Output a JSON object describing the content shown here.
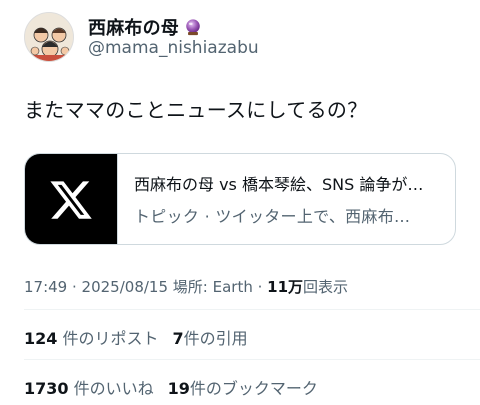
{
  "author": {
    "display_name": "西麻布の母",
    "handle": "@mama_nishiazabu"
  },
  "tweet": {
    "text": "またママのことニュースにしてるの？"
  },
  "card": {
    "title": "西麻布の母 vs 橋本琴絵、SNS 論争が…",
    "subtitle": "トピック · ツイッター上で、西麻布…"
  },
  "meta": {
    "time": "17:49",
    "sep1": " · ",
    "date": "2025/08/15",
    "location_label": " 場所: ",
    "location": "Earth",
    "sep2": " · ",
    "views_count": "11万",
    "views_label": "回表示"
  },
  "stats_row1": {
    "reposts_count": "124",
    "reposts_label": "件のリポスト",
    "quotes_count": "7",
    "quotes_label": "件の引用"
  },
  "stats_row2": {
    "likes_count": "1730",
    "likes_label": "件のいいね",
    "bookmarks_count": "19",
    "bookmarks_label": "件のブックマーク"
  },
  "icons": [
    "avatar",
    "crystal-ball-icon",
    "x-logo-icon"
  ],
  "colors": {
    "text_primary": "#0f1419",
    "text_secondary": "#536471",
    "border": "#cfd9de",
    "crystal": "#8e44ad"
  }
}
